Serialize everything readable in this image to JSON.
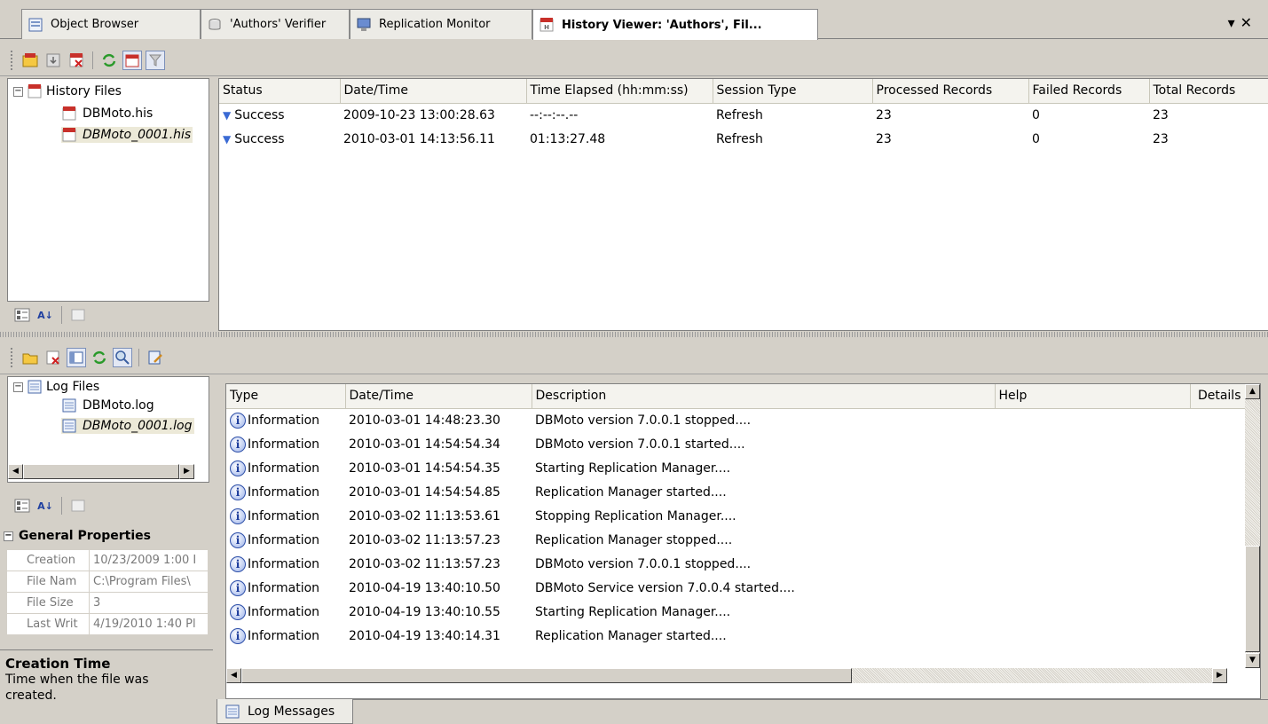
{
  "tabs": [
    {
      "label": "Object Browser",
      "icon": "object-browser-icon"
    },
    {
      "label": "'Authors' Verifier",
      "icon": "verifier-icon"
    },
    {
      "label": "Replication Monitor",
      "icon": "monitor-icon"
    },
    {
      "label": "History Viewer: 'Authors', Fil...",
      "icon": "history-viewer-icon",
      "active": true
    }
  ],
  "tab_controls": {
    "dropdown": "▾",
    "close": "✕"
  },
  "history_toolbar": [
    "open-history-icon",
    "import-icon",
    "delete-history-icon",
    "refresh-icon",
    "calendar-icon",
    "filter-icon"
  ],
  "history_tree": {
    "root": {
      "label": "History Files",
      "expander": "−"
    },
    "items": [
      {
        "label": "DBMoto.his",
        "italic": false
      },
      {
        "label": "DBMoto_0001.his",
        "italic": true
      }
    ]
  },
  "history_grid": {
    "columns": [
      "Status",
      "Date/Time",
      "Time Elapsed (hh:mm:ss)",
      "Session Type",
      "Processed Records",
      "Failed Records",
      "Total Records"
    ],
    "rows": [
      [
        "Success",
        "2009-10-23 13:00:28.63",
        "--:--:--.--",
        "Refresh",
        "23",
        "0",
        "23"
      ],
      [
        "Success",
        "2010-03-01 14:13:56.11",
        "01:13:27.48",
        "Refresh",
        "23",
        "0",
        "23"
      ]
    ]
  },
  "log_toolbar": [
    "open-log-icon",
    "delete-log-icon",
    "view-icon",
    "refresh-icon",
    "find-icon",
    "edit-icon"
  ],
  "log_tree": {
    "root": {
      "label": "Log Files",
      "expander": "−"
    },
    "items": [
      {
        "label": "DBMoto.log",
        "italic": false
      },
      {
        "label": "DBMoto_0001.log",
        "italic": true
      }
    ]
  },
  "properties": {
    "section": "General Properties",
    "section_expander": "−",
    "rows": [
      {
        "name": "Creation",
        "value": "10/23/2009 1:00 I"
      },
      {
        "name": "File Nam",
        "value": "C:\\Program Files\\"
      },
      {
        "name": "File Size",
        "value": "3"
      },
      {
        "name": "Last Writ",
        "value": "4/19/2010 1:40 Pl"
      }
    ],
    "help_title": "Creation Time",
    "help_text": "Time when the file was created."
  },
  "log_grid": {
    "columns": [
      "Type",
      "Date/Time",
      "Description",
      "Help",
      "Details"
    ],
    "rows": [
      [
        "Information",
        "2010-03-01 14:48:23.30",
        "DBMoto version 7.0.0.1 stopped...."
      ],
      [
        "Information",
        "2010-03-01 14:54:54.34",
        "DBMoto version 7.0.0.1 started...."
      ],
      [
        "Information",
        "2010-03-01 14:54:54.35",
        "Starting Replication Manager...."
      ],
      [
        "Information",
        "2010-03-01 14:54:54.85",
        "Replication Manager started...."
      ],
      [
        "Information",
        "2010-03-02 11:13:53.61",
        "Stopping Replication Manager...."
      ],
      [
        "Information",
        "2010-03-02 11:13:57.23",
        "Replication Manager stopped...."
      ],
      [
        "Information",
        "2010-03-02 11:13:57.23",
        "DBMoto version 7.0.0.1 stopped...."
      ],
      [
        "Information",
        "2010-04-19 13:40:10.50",
        "DBMoto Service version 7.0.0.4 started...."
      ],
      [
        "Information",
        "2010-04-19 13:40:10.55",
        "Starting Replication Manager...."
      ],
      [
        "Information",
        "2010-04-19 13:40:14.31",
        "Replication Manager started...."
      ]
    ]
  },
  "bottom_tab": {
    "label": "Log Messages"
  }
}
